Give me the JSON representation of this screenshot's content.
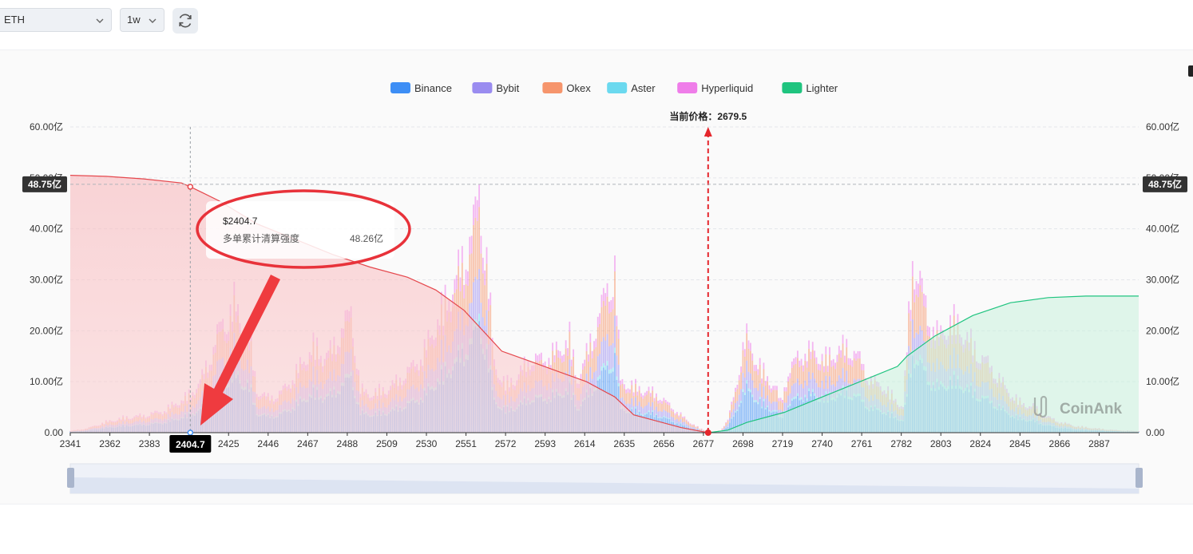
{
  "controls": {
    "symbol": "ETH",
    "interval": "1w"
  },
  "legend": [
    {
      "name": "Binance",
      "color": "#3d8ef5"
    },
    {
      "name": "Bybit",
      "color": "#9a8cf0"
    },
    {
      "name": "Okex",
      "color": "#f6956c"
    },
    {
      "name": "Aster",
      "color": "#6bd9ef"
    },
    {
      "name": "Hyperliquid",
      "color": "#ef7de9"
    },
    {
      "name": "Lighter",
      "color": "#1fc47f"
    }
  ],
  "current_price_label": "当前价格：2679.5",
  "axis_pointer": {
    "x_value": "2404.7",
    "y_value": "48.75亿"
  },
  "tooltip": {
    "title": "$2404.7",
    "row_label": "多单累计清算强度",
    "row_value": "48.26亿"
  },
  "watermark": "CoinAnk",
  "chart_data": {
    "type": "bar",
    "x_ticks": [
      "2341",
      "2362",
      "2383",
      "2404.7",
      "2425",
      "2446",
      "2467",
      "2488",
      "2509",
      "2530",
      "2551",
      "2572",
      "2593",
      "2614",
      "2635",
      "2656",
      "2677",
      "2698",
      "2719",
      "2740",
      "2761",
      "2782",
      "2803",
      "2824",
      "2845",
      "2866",
      "2887"
    ],
    "y_ticks": [
      "0.00",
      "10.00亿",
      "20.00亿",
      "30.00亿",
      "40.00亿",
      "50.00亿",
      "60.00亿"
    ],
    "ylim": [
      0,
      60
    ],
    "xlim": [
      2341,
      2908
    ],
    "current_price": 2679.5,
    "bar_envelope": [
      [
        2341,
        0.4
      ],
      [
        2350,
        1
      ],
      [
        2360,
        2.5
      ],
      [
        2370,
        3.5
      ],
      [
        2380,
        4
      ],
      [
        2390,
        5
      ],
      [
        2398,
        7
      ],
      [
        2405,
        9
      ],
      [
        2410,
        12
      ],
      [
        2415,
        17
      ],
      [
        2420,
        24
      ],
      [
        2425,
        27
      ],
      [
        2428,
        30
      ],
      [
        2432,
        25
      ],
      [
        2436,
        23
      ],
      [
        2440,
        10
      ],
      [
        2446,
        8
      ],
      [
        2452,
        9
      ],
      [
        2458,
        12
      ],
      [
        2464,
        16
      ],
      [
        2470,
        20
      ],
      [
        2475,
        18
      ],
      [
        2480,
        19
      ],
      [
        2485,
        24
      ],
      [
        2490,
        28
      ],
      [
        2495,
        10
      ],
      [
        2500,
        9
      ],
      [
        2508,
        10
      ],
      [
        2515,
        12
      ],
      [
        2522,
        15
      ],
      [
        2528,
        18
      ],
      [
        2535,
        25
      ],
      [
        2540,
        30
      ],
      [
        2545,
        35
      ],
      [
        2550,
        40
      ],
      [
        2555,
        48
      ],
      [
        2558,
        55
      ],
      [
        2562,
        40
      ],
      [
        2566,
        16
      ],
      [
        2572,
        11
      ],
      [
        2578,
        13
      ],
      [
        2585,
        17
      ],
      [
        2592,
        17
      ],
      [
        2600,
        19
      ],
      [
        2606,
        22
      ],
      [
        2610,
        12
      ],
      [
        2615,
        18
      ],
      [
        2620,
        25
      ],
      [
        2625,
        32
      ],
      [
        2630,
        38
      ],
      [
        2633,
        12
      ],
      [
        2638,
        11
      ],
      [
        2645,
        10
      ],
      [
        2652,
        9
      ],
      [
        2660,
        6
      ],
      [
        2668,
        3
      ],
      [
        2675,
        1
      ],
      [
        2681,
        0
      ],
      [
        2686,
        0.5
      ],
      [
        2690,
        3
      ],
      [
        2694,
        10
      ],
      [
        2697,
        18
      ],
      [
        2700,
        22
      ],
      [
        2705,
        17
      ],
      [
        2710,
        13
      ],
      [
        2715,
        11
      ],
      [
        2718,
        7
      ],
      [
        2722,
        14
      ],
      [
        2728,
        18
      ],
      [
        2735,
        19
      ],
      [
        2742,
        17
      ],
      [
        2748,
        19
      ],
      [
        2754,
        20
      ],
      [
        2760,
        17
      ],
      [
        2766,
        12
      ],
      [
        2772,
        11
      ],
      [
        2778,
        8
      ],
      [
        2783,
        6
      ],
      [
        2788,
        40
      ],
      [
        2792,
        35
      ],
      [
        2796,
        27
      ],
      [
        2802,
        22
      ],
      [
        2808,
        26
      ],
      [
        2814,
        24
      ],
      [
        2820,
        20
      ],
      [
        2826,
        17
      ],
      [
        2832,
        14
      ],
      [
        2838,
        10
      ],
      [
        2845,
        7
      ],
      [
        2852,
        6
      ],
      [
        2858,
        4
      ],
      [
        2866,
        2.5
      ],
      [
        2875,
        1.5
      ],
      [
        2885,
        1
      ],
      [
        2895,
        0.6
      ],
      [
        2905,
        0.4
      ]
    ],
    "series_share": {
      "Binance": 0.45,
      "Bybit": 0.18,
      "Okex": 0.25,
      "Aster": 0.03,
      "Hyperliquid": 0.09
    },
    "long_cumulative": [
      [
        2341,
        50.5
      ],
      [
        2360,
        50.3
      ],
      [
        2380,
        49.8
      ],
      [
        2400,
        49
      ],
      [
        2404.7,
        48.26
      ],
      [
        2420,
        45.5
      ],
      [
        2440,
        41
      ],
      [
        2460,
        38
      ],
      [
        2480,
        35
      ],
      [
        2500,
        32.5
      ],
      [
        2520,
        30.5
      ],
      [
        2535,
        28
      ],
      [
        2550,
        24
      ],
      [
        2560,
        20
      ],
      [
        2570,
        16
      ],
      [
        2585,
        14
      ],
      [
        2600,
        12
      ],
      [
        2615,
        10
      ],
      [
        2630,
        7
      ],
      [
        2640,
        3.5
      ],
      [
        2655,
        2
      ],
      [
        2665,
        1
      ],
      [
        2679.5,
        0
      ]
    ],
    "short_cumulative": [
      [
        2679.5,
        0
      ],
      [
        2690,
        0.5
      ],
      [
        2700,
        2
      ],
      [
        2720,
        4
      ],
      [
        2740,
        7
      ],
      [
        2760,
        10
      ],
      [
        2780,
        13
      ],
      [
        2785,
        15
      ],
      [
        2800,
        19
      ],
      [
        2820,
        23
      ],
      [
        2840,
        25.5
      ],
      [
        2860,
        26.5
      ],
      [
        2880,
        26.8
      ],
      [
        2908,
        26.8
      ]
    ]
  }
}
